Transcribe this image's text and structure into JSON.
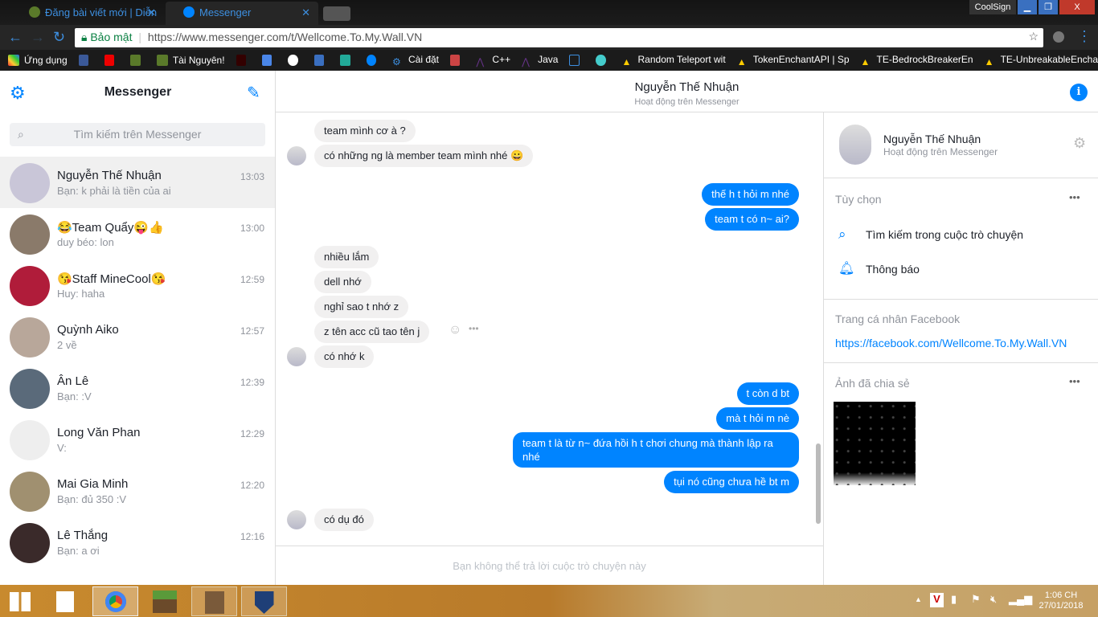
{
  "browser": {
    "tabs": [
      {
        "label": "Đăng bài viết mới | Diễn",
        "close": "✕"
      },
      {
        "label": "Messenger",
        "close": "✕"
      }
    ],
    "window_button": "CoolSign",
    "secure_label": "Bảo mật",
    "url": "https://www.messenger.com/t/Wellcome.To.My.Wall.VN",
    "bookmarks": [
      "Ứng dụng",
      "Tài Nguyên!",
      "Cài đặt",
      "C++",
      "Java",
      "Random Teleport wit",
      "TokenEnchantAPI | Sp",
      "TE-BedrockBreakerEn",
      "TE-UnbreakableEncha"
    ]
  },
  "sidebar": {
    "title": "Messenger",
    "search_placeholder": "Tìm kiếm trên Messenger",
    "conversations": [
      {
        "name": "Nguyễn Thế Nhuận",
        "preview": "Bạn: k phải là tiền của ai",
        "time": "13:03",
        "color": "#c9c6d8"
      },
      {
        "name": "😂Team Quẩy😜👍",
        "preview": "duy béo: lon",
        "time": "13:00",
        "color": "#8a7a6a"
      },
      {
        "name": "😘Staff MineCool😘",
        "preview": "Huy: haha",
        "time": "12:59",
        "color": "#b01c3a"
      },
      {
        "name": "Quỳnh Aiko",
        "preview": "2 về",
        "time": "12:57",
        "color": "#b8a79a"
      },
      {
        "name": "Ân Lê",
        "preview": "Bạn: :V",
        "time": "12:39",
        "color": "#5a6a7a"
      },
      {
        "name": "Long Văn Phan",
        "preview": "V:",
        "time": "12:29",
        "color": "#eeeeee"
      },
      {
        "name": "Mai Gia Minh",
        "preview": "Bạn: đủ 350 :V",
        "time": "12:20",
        "color": "#a09070"
      },
      {
        "name": "Lê Thắng",
        "preview": "Bạn: a ơi",
        "time": "12:16",
        "color": "#3a2a2a"
      }
    ]
  },
  "chat": {
    "name": "Nguyễn Thế Nhuận",
    "status": "Hoạt động trên Messenger",
    "messages": [
      {
        "dir": "in",
        "text": "team mình cơ à ?"
      },
      {
        "dir": "in",
        "text": "có những ng là member team mình nhé 😀"
      },
      {
        "dir": "out",
        "text": "thế h t hỏi m nhé"
      },
      {
        "dir": "out",
        "text": "team t có n~ ai?"
      },
      {
        "dir": "in",
        "text": "nhiều lắm"
      },
      {
        "dir": "in",
        "text": "dell nhớ"
      },
      {
        "dir": "in",
        "text": "nghỉ sao t nhớ z"
      },
      {
        "dir": "in",
        "text": "z tên acc cũ tao tên j"
      },
      {
        "dir": "in",
        "text": "có nhớ k"
      },
      {
        "dir": "out",
        "text": "t còn d bt"
      },
      {
        "dir": "out",
        "text": "mà t hỏi m nè"
      },
      {
        "dir": "out",
        "text": "team t là từ n~ đứa hồi h t chơi chung mà thành lập ra nhé"
      },
      {
        "dir": "out",
        "text": "tụi nó cũng chưa hề bt m"
      },
      {
        "dir": "in",
        "text": "có dụ đó"
      }
    ],
    "composer_notice": "Bạn không thể trả lời cuộc trò chuyện này"
  },
  "details": {
    "name": "Nguyễn Thế Nhuận",
    "status": "Hoạt động trên Messenger",
    "options_label": "Tùy chọn",
    "search_label": "Tìm kiếm trong cuộc trò chuyện",
    "notify_label": "Thông báo",
    "profile_label": "Trang cá nhân Facebook",
    "profile_link": "https://facebook.com/Wellcome.To.My.Wall.VN",
    "shared_label": "Ảnh đã chia sẻ",
    "more": "•••"
  },
  "taskbar": {
    "time": "1:06 CH",
    "date": "27/01/2018"
  },
  "colors": {
    "accent": "#0084ff",
    "taskbar": "#c88a2e"
  }
}
